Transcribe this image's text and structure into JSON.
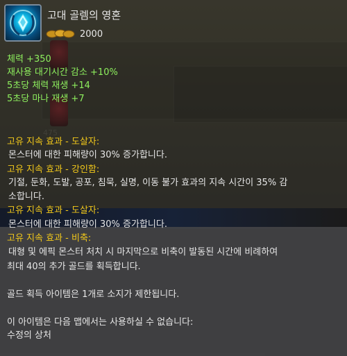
{
  "item": {
    "name": "고대 골렘의 영혼",
    "icon": "blue-crystal-icon",
    "price": "2000"
  },
  "stats": [
    "체력 +350",
    "재사용 대기시간 감소 +10%",
    "5초당 체력 재생 +14",
    "5초당 마나 재생 +7"
  ],
  "passives": [
    {
      "title": "고유 지속 효과 - 도살자:",
      "lines": [
        "몬스터에 대한 피해량이 30% 증가합니다."
      ]
    },
    {
      "title": "고유 지속 효과 - 강인함:",
      "lines": [
        "기절, 둔화, 도발, 공포, 침묵, 실명, 이동 불가 효과의 지속 시간이 35% 감",
        "소합니다."
      ]
    },
    {
      "title": "고유 지속 효과 - 도살자:",
      "lines": [
        "몬스터에 대한 피해량이 30% 증가합니다."
      ]
    },
    {
      "title": "고유 지속 효과 - 비축:",
      "lines": [
        "대형 및 에픽 몬스터 처치 시 마지막으로 비축이 발동된 시간에 비례하여",
        "최대 40의 추가 골드를 획득합니다."
      ]
    }
  ],
  "notes": [
    "골드 획득 아이템은 1개로 소지가 제한됩니다.",
    "이 아이템은 다음 맵에서는 사용하실 수 없습니다:",
    "수정의 상처"
  ],
  "background": {
    "slot_number": "475"
  },
  "colors": {
    "stat": "#8ef05e",
    "passive_title": "#f2c81a",
    "text": "#e6e6e6"
  }
}
